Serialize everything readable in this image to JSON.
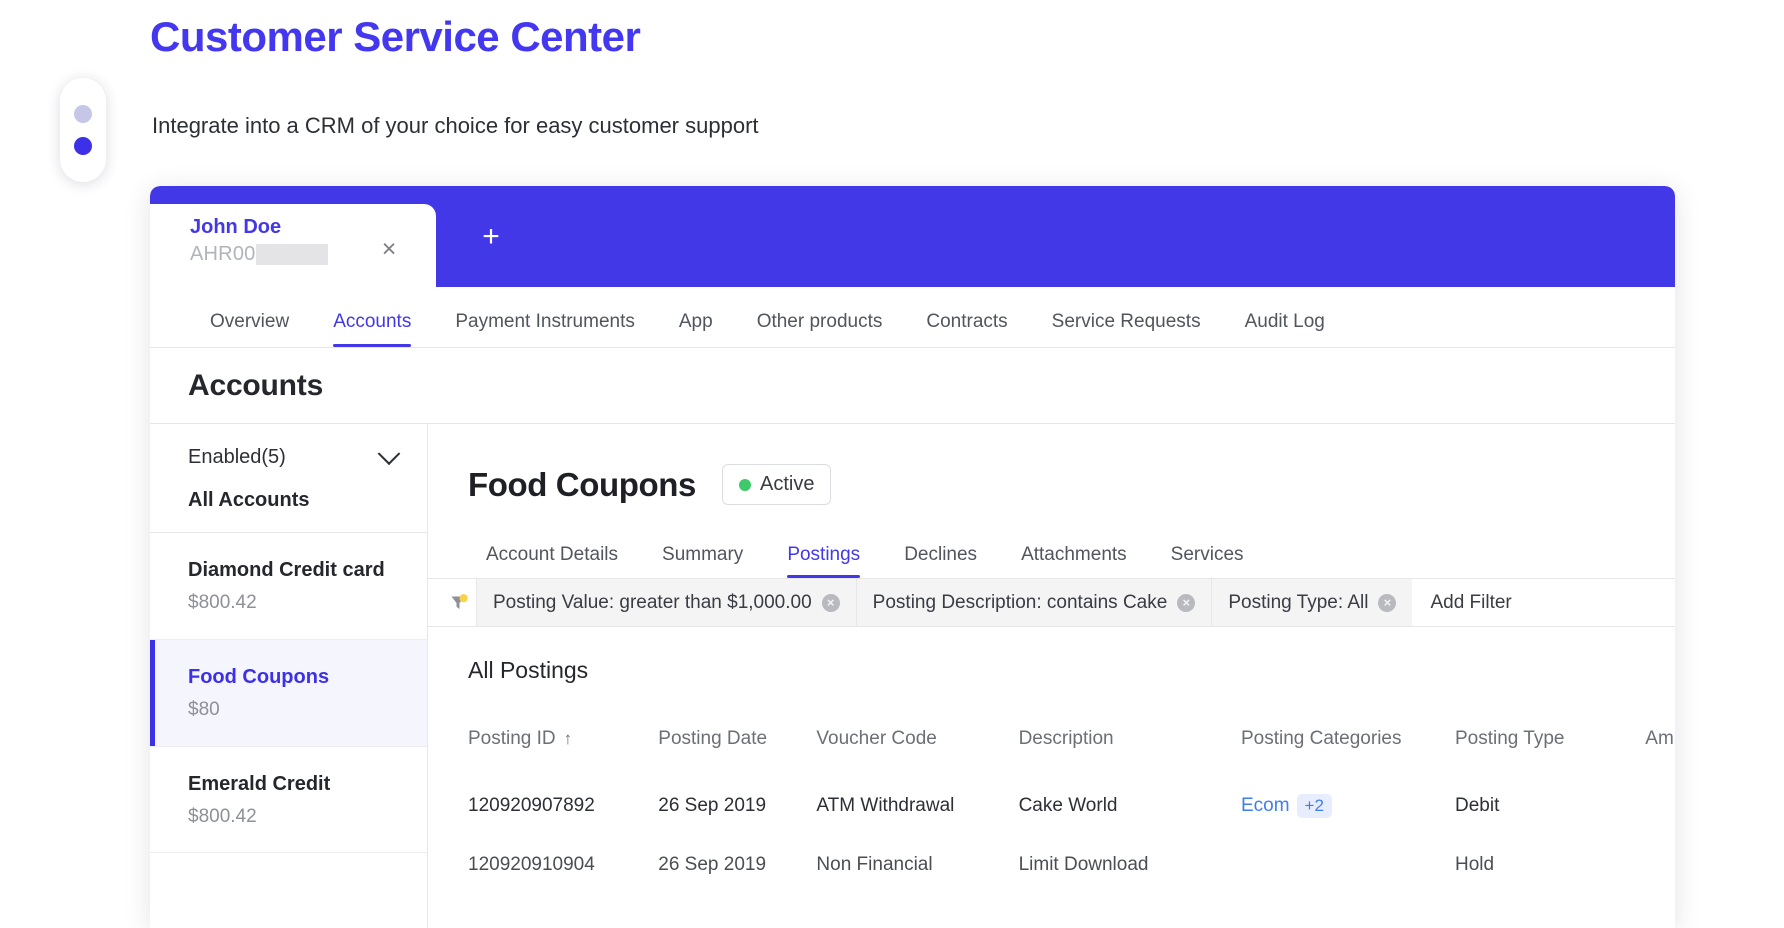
{
  "page": {
    "title": "Customer Service Center",
    "subtitle": "Integrate into a CRM of your choice for easy customer support"
  },
  "carousel": {
    "dots": [
      {
        "name": "slide-1",
        "active": false
      },
      {
        "name": "slide-2",
        "active": true
      }
    ]
  },
  "browser_tabs": {
    "client_tab": {
      "name": "John Doe",
      "id_prefix": "AHR00",
      "id_redacted": true,
      "close_label": "×"
    },
    "new_tab_label": "+"
  },
  "nav_tabs": [
    {
      "label": "Overview",
      "active": false
    },
    {
      "label": "Accounts",
      "active": true
    },
    {
      "label": "Payment Instruments",
      "active": false
    },
    {
      "label": "App",
      "active": false
    },
    {
      "label": "Other products",
      "active": false
    },
    {
      "label": "Contracts",
      "active": false
    },
    {
      "label": "Service Requests",
      "active": false
    },
    {
      "label": "Audit Log",
      "active": false
    }
  ],
  "section": {
    "heading": "Accounts"
  },
  "sidebar": {
    "filter_label": "Enabled(5)",
    "all_accounts_label": "All Accounts",
    "accounts": [
      {
        "name": "Diamond Credit card",
        "balance": "$800.42",
        "selected": false
      },
      {
        "name": "Food Coupons",
        "balance": "$80",
        "selected": true
      },
      {
        "name": "Emerald Credit",
        "balance": "$800.42",
        "selected": false
      }
    ]
  },
  "detail": {
    "title": "Food Coupons",
    "status": "Active",
    "status_color": "#3ec96a",
    "sub_tabs": [
      {
        "label": "Account Details",
        "active": false
      },
      {
        "label": "Summary",
        "active": false
      },
      {
        "label": "Postings",
        "active": true
      },
      {
        "label": "Declines",
        "active": false
      },
      {
        "label": "Attachments",
        "active": false
      },
      {
        "label": "Services",
        "active": false
      }
    ],
    "filters": {
      "icon": "filter-funnel-icon",
      "chips": [
        {
          "label": "Posting Value: greater than $1,000.00"
        },
        {
          "label": "Posting Description: contains Cake"
        },
        {
          "label": "Posting Type: All"
        }
      ],
      "add_filter_label": "Add Filter"
    },
    "table": {
      "title": "All Postings",
      "sort_column": "Posting ID",
      "sort_direction": "asc",
      "sort_glyph": "↑",
      "columns": [
        "Posting ID",
        "Posting Date",
        "Voucher Code",
        "Description",
        "Posting Categories",
        "Posting Type",
        "Am"
      ],
      "rows": [
        {
          "posting_id": "120920907892",
          "posting_date": "26 Sep 2019",
          "voucher_code": "ATM Withdrawal",
          "description": "Cake World",
          "category": "Ecom",
          "category_more": "+2",
          "posting_type": "Debit",
          "amount": ""
        },
        {
          "posting_id": "120920910904",
          "posting_date": "26 Sep 2019",
          "voucher_code": "Non Financial",
          "description": "Limit Download",
          "category": "",
          "category_more": "",
          "posting_type": "Hold",
          "amount": ""
        }
      ]
    }
  },
  "colors": {
    "brand": "#4338e8",
    "accent_blue": "#3f7ef0",
    "status_green": "#3ec96a",
    "selected_bg": "#f4f5fd"
  }
}
